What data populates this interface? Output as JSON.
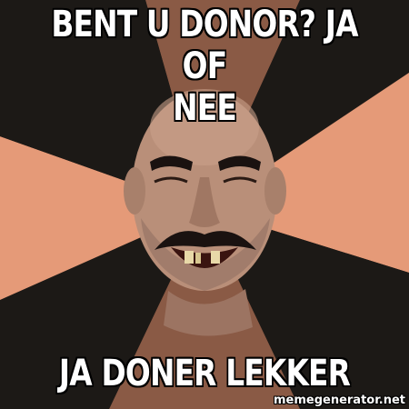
{
  "meme": {
    "top_line_1": "BENT U DONOR? JA OF",
    "top_line_2": "NEE",
    "bottom_text": "JA DONER LEKKER",
    "watermark": "memegenerator.net"
  },
  "colors": {
    "dark": "#1c1916",
    "brown": "#8a5a45",
    "peach": "#e59a78",
    "skin": "#b98f79",
    "mustache": "#1a1210"
  }
}
